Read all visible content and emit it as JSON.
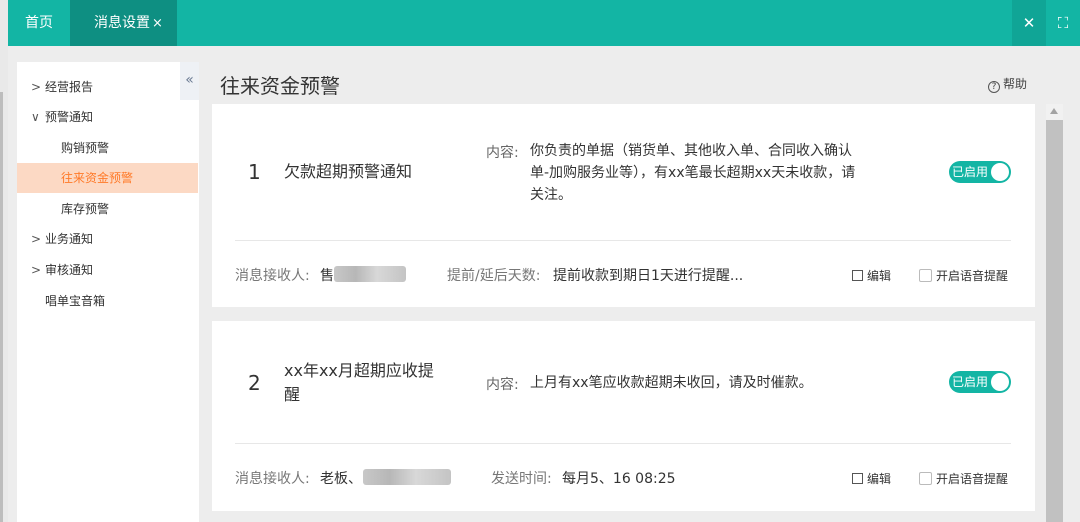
{
  "tabs": {
    "home": "首页",
    "settings": "消息设置",
    "settings_close": "×"
  },
  "window_controls": {
    "close": "✕",
    "fullscreen": "⛶"
  },
  "sidebar": {
    "collapse_icon": "«",
    "items": [
      {
        "label": "经营报告",
        "arrow": ">"
      },
      {
        "label": "预警通知",
        "arrow": "∨"
      },
      {
        "label": "购销预警"
      },
      {
        "label": "往来资金预警"
      },
      {
        "label": "库存预警"
      },
      {
        "label": "业务通知",
        "arrow": ">"
      },
      {
        "label": "审核通知",
        "arrow": ">"
      },
      {
        "label": "唱单宝音箱"
      }
    ]
  },
  "main": {
    "title": "往来资金预警",
    "help": "帮助"
  },
  "cards": [
    {
      "number": "1",
      "name": "欠款超期预警通知",
      "content_label": "内容:",
      "content_line1": "你负责的单据（销货单、其他收入单、合同收入确认",
      "content_line2": "单-加购服务业等），有xx笔最长超期xx天未收款，请",
      "content_line3": "关注。",
      "toggle": "已启用",
      "receiver_label": "消息接收人:",
      "receiver_value": "售",
      "days_label": "提前/延后天数:",
      "days_value": "提前收款到期日1天进行提醒...",
      "edit": "编辑",
      "voice": "开启语音提醒"
    },
    {
      "number": "2",
      "name_line1": "xx年xx月超期应收提",
      "name_line2": "醒",
      "content_label": "内容:",
      "content_line1": "上月有xx笔应收款超期未收回，请及时催款。",
      "toggle": "已启用",
      "receiver_label": "消息接收人:",
      "receiver_value": "老板、",
      "send_label": "发送时间:",
      "send_value": "每月5、16 08:25",
      "edit": "编辑",
      "voice": "开启语音提醒"
    }
  ],
  "colors": {
    "primary": "#13b5a4",
    "active_tab": "#0e8f82",
    "sidebar_active_bg": "#fcd9c4",
    "sidebar_active_text": "#ff7a29"
  }
}
